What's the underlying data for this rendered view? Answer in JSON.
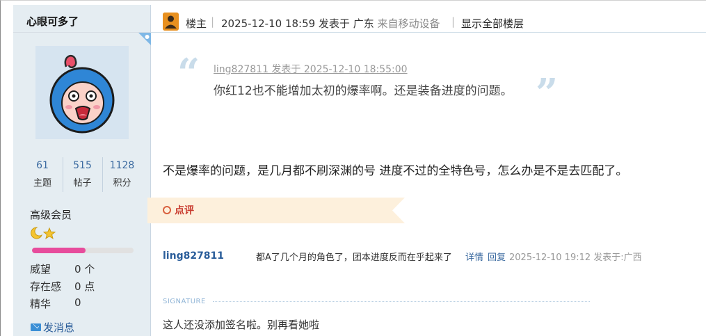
{
  "author": {
    "name": "心眼可多了",
    "stats": [
      {
        "value": "61",
        "label": "主题"
      },
      {
        "value": "515",
        "label": "帖子"
      },
      {
        "value": "1128",
        "label": "积分"
      }
    ],
    "level_title": "高级会员",
    "level_progress": 0.53,
    "props": [
      {
        "key": "威望",
        "value": "0 个"
      },
      {
        "key": "存在感",
        "value": "0 点"
      },
      {
        "key": "精华",
        "value": "0"
      }
    ],
    "send_message": "发消息"
  },
  "post_header": {
    "floor_label": "楼主",
    "separator": "|",
    "posted_at": "2025-12-10 18:59 发表于 广东",
    "device": "来自移动设备",
    "show_all": "显示全部楼层"
  },
  "quote": {
    "open_mark": "“",
    "close_mark": "”",
    "meta": "ling827811 发表于 2025-12-10 18:55:00",
    "body": "你红12也不能增加太初的爆率啊。还是装备进度的问题。"
  },
  "post_body": "不是爆率的问题，是几月都不刷深渊的号 进度不过的全特色号，怎么办是不是去匹配了。",
  "comments": {
    "banner_label": "点评",
    "items": [
      {
        "user": "ling827811",
        "text": "都A了几个月的角色了，团本进度反而在乎起来了",
        "detail_link": "详情",
        "reply_link": "回复",
        "time": "2025-12-10 19:12 发表于:广西"
      }
    ]
  },
  "signature": {
    "label": "SIGNATURE",
    "text": "这人还没添加签名啦。别再看她啦"
  },
  "colors": {
    "sidebar_bg": "#e5edf2",
    "link_blue": "#2a5d9a",
    "comment_red": "#c83a2e",
    "level_bar_pink": "#e74c9c",
    "floor_icon_orange": "#e8901f"
  }
}
